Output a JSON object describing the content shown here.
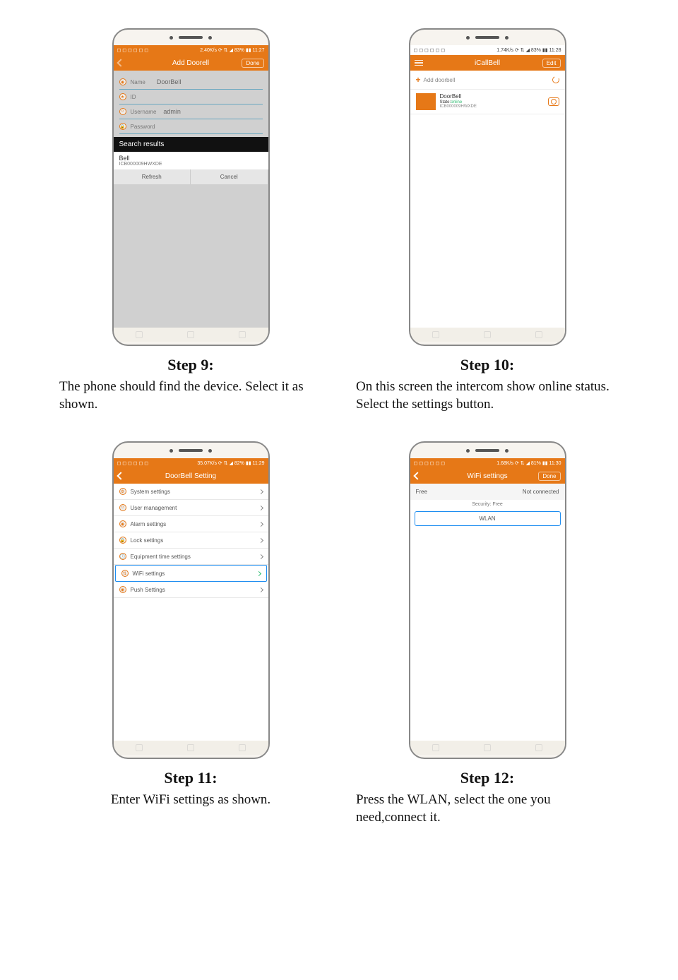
{
  "step9": {
    "statusbar": {
      "left": "◻ ◻ ◻ ◻ ◻ ◻",
      "right": "2.40K/s ⟳ ⇅ ◢ 83% ▮▮ 11:27"
    },
    "title": "Add Doorell",
    "done": "Done",
    "form": {
      "name_label": "Name",
      "name_value": "DoorBell",
      "id_label": "ID",
      "user_label": "Username",
      "user_value": "admin",
      "pw_label": "Password"
    },
    "search_header": "Search results",
    "result": {
      "name": "Bell",
      "id": "ICB000009HWXDE"
    },
    "refresh": "Refresh",
    "cancel": "Cancel",
    "caption_title": "Step 9:",
    "caption": "The phone should find the device. Select it as shown."
  },
  "step10": {
    "statusbar": {
      "left": "◻ ◻ ◻ ◻ ◻ ◻",
      "right": "1.74K/s ⟳ ⇅ ◢ 83% ▮▮ 11:28"
    },
    "title": "iCallBell",
    "edit": "Edit",
    "add_doorbell": "Add doorbell",
    "device": {
      "name": "DoorBell",
      "state_label": "State:",
      "state": "online",
      "id": "ICB000009HWXDE"
    },
    "caption_title": "Step 10:",
    "caption": "On this screen the intercom show online status.\nSelect the settings button."
  },
  "step11": {
    "statusbar": {
      "left": "◻ ◻ ◻ ◻ ◻ ◻",
      "right": "35.07K/s ⟳ ⇅ ◢ 82% ▮▮ 11:29"
    },
    "title": "DoorBell  Setting",
    "rows": [
      "System settings",
      "User management",
      "Alarm settings",
      "Lock settings",
      "Equipment time settings",
      "WiFi settings",
      "Push Settings"
    ],
    "caption_title": "Step 11:",
    "caption": "Enter WiFi settings as shown."
  },
  "step12": {
    "statusbar": {
      "left": "◻ ◻ ◻ ◻ ◻ ◻",
      "right": "1.68K/s ⟳ ⇅ ◢ 81% ▮▮ 11:30"
    },
    "title": "WiFi settings",
    "done": "Done",
    "net_name": "Free",
    "net_status": "Not connected",
    "security": "Security: Free",
    "wlan": "WLAN",
    "caption_title": "Step 12:",
    "caption": "Press the WLAN, select the one you need,connect it."
  }
}
